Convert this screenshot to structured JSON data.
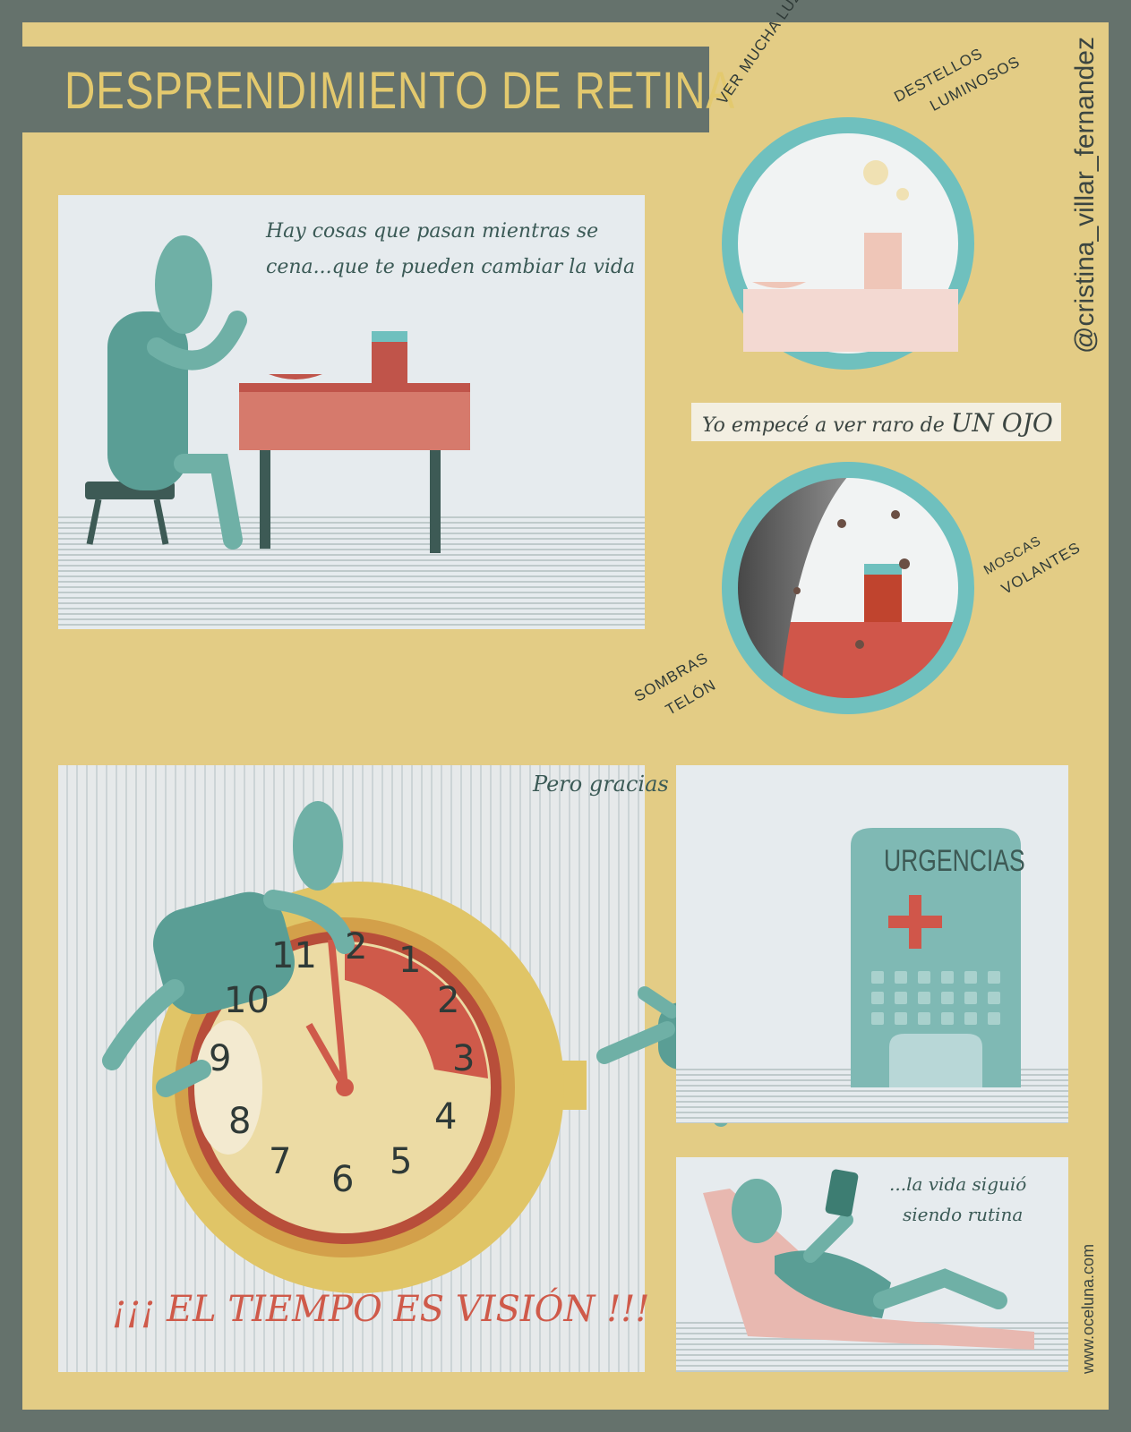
{
  "title": "DESPRENDIMIENTO DE RETINA",
  "panel1": {
    "caption_line1": "Hay cosas que pasan mientras se",
    "caption_line2": "cena...que te pueden cambiar la vida"
  },
  "circle1": {
    "label_light": "VER MUCHA LUZ",
    "label_flash_line1": "DESTELLOS",
    "label_flash_line2": "LUMINOSOS"
  },
  "banner": {
    "text_start": "Yo empecé a ver raro de ",
    "text_emph": "UN OJO"
  },
  "circle2": {
    "label_floaters_line1": "MOSCAS",
    "label_floaters_line2": "VOLANTES",
    "label_shadow_line1": "SOMBRAS",
    "label_shadow_line2": "TELÓN"
  },
  "clock_panel": {
    "slogan": "¡¡¡ EL TIEMPO ES VISIÓN !!!",
    "numbers": [
      "11",
      "2",
      "1",
      "2",
      "3",
      "4",
      "5",
      "6",
      "7",
      "8",
      "9",
      "10"
    ]
  },
  "panel3": {
    "caption": "Pero gracias a que tomé la decisión correcta...",
    "building_sign": "URGENCIAS"
  },
  "panel4": {
    "caption_line1": "...la vida siguió",
    "caption_line2": "siendo rutina"
  },
  "credits": {
    "handle": "@cristina_villar_fernandez",
    "website": "www.oceluna.com"
  },
  "colors": {
    "border": "#65726c",
    "background": "#e3cc85",
    "teal": "#5a9e95",
    "ring": "#6fc0be",
    "red": "#d0564a",
    "title": "#e3c96e"
  }
}
